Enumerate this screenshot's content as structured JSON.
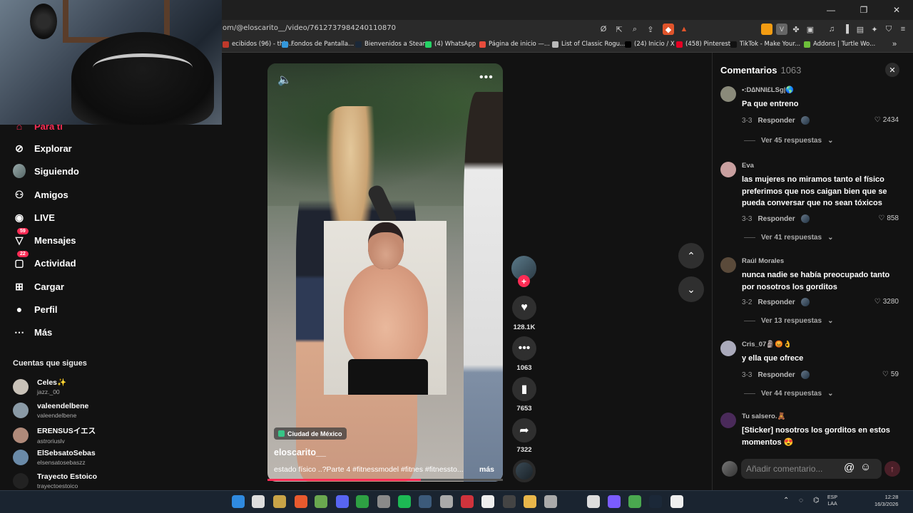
{
  "browser": {
    "url": "om/@eloscarito__/video/7612737984240110870",
    "bookmarks": [
      {
        "label": "ecibidos (96) - thia...",
        "color": "#c0392b"
      },
      {
        "label": "Fondos de Pantalla...",
        "color": "#3498db"
      },
      {
        "label": "Bienvenidos a Steam",
        "color": "#1b2838"
      },
      {
        "label": "(4) WhatsApp",
        "color": "#25d366"
      },
      {
        "label": "Página de inicio —...",
        "color": "#e74c3c"
      },
      {
        "label": "List of Classic Rogu...",
        "color": "#bbbbbb"
      },
      {
        "label": "(24) Inicio / X",
        "color": "#000000"
      },
      {
        "label": "(458) Pinterest",
        "color": "#e60023"
      },
      {
        "label": "TikTok - Make Your...",
        "color": "#111111"
      },
      {
        "label": "Addons | Turtle Wo...",
        "color": "#6dbf3a"
      }
    ]
  },
  "sidebar": {
    "items": [
      {
        "label": "Para ti",
        "icon": "home-icon"
      },
      {
        "label": "Explorar",
        "icon": "compass-icon"
      },
      {
        "label": "Siguiendo",
        "icon": "avatar"
      },
      {
        "label": "Amigos",
        "icon": "friends-icon"
      },
      {
        "label": "LIVE",
        "icon": "live-icon"
      },
      {
        "label": "Mensajes",
        "icon": "message-icon",
        "badge": "59"
      },
      {
        "label": "Actividad",
        "icon": "activity-icon",
        "badge": "22"
      },
      {
        "label": "Cargar",
        "icon": "upload-icon"
      },
      {
        "label": "Perfil",
        "icon": "profile-icon"
      },
      {
        "label": "Más",
        "icon": "more-icon"
      }
    ],
    "following_title": "Cuentas que sigues",
    "accounts": [
      {
        "name": "Celes✨",
        "user": "jazz._00"
      },
      {
        "name": "valeendelbene",
        "user": "valeendelbene"
      },
      {
        "name": "ERENSUSイエス",
        "user": "astroriuslv"
      },
      {
        "name": "ElSebsatoSebas",
        "user": "elsensatosebaszz"
      },
      {
        "name": "Trayecto Estoico",
        "user": "trayectoestoico"
      }
    ]
  },
  "video": {
    "location": "Ciudad de México",
    "author": "eloscarito__",
    "caption": "estado físico ..?Parte 4 #fitnessmodel #fitnes #fitnessto...",
    "more": "más",
    "progress": 0.65
  },
  "actions": {
    "likes": "128.1K",
    "comments": "1063",
    "saves": "7653",
    "shares": "7322"
  },
  "comments_panel": {
    "title": "Comentarios",
    "count": "1063",
    "input_placeholder": "Añadir comentario...",
    "reply_label": "Responder",
    "items": [
      {
        "user": "•:D∆NNI£LSg|🌎",
        "text": "Pa que entreno",
        "date": "3-3",
        "likes": "2434",
        "replies": "Ver 45 respuestas"
      },
      {
        "user": "Eva",
        "text": "las mujeres no miramos tanto el físico preferimos que nos caigan bien que se pueda conversar que no sean tóxicos",
        "date": "3-3",
        "likes": "858",
        "replies": "Ver 41 respuestas"
      },
      {
        "user": "Raúl Morales",
        "text": "nunca nadie se había preocupado tanto por nosotros los gorditos",
        "date": "3-2",
        "likes": "3280",
        "replies": "Ver 13 respuestas"
      },
      {
        "user": "Cris_07🗿😡👌",
        "text": "y ella que ofrece",
        "date": "3-3",
        "likes": "59",
        "replies": "Ver 44 respuestas"
      },
      {
        "user": "Tu salsero.🧸",
        "text": "[Sticker] nosotros los gorditos en estos momentos 😍",
        "date": "",
        "likes": "",
        "replies": ""
      }
    ]
  },
  "taskbar": {
    "lang_top": "ESP",
    "lang_bottom": "LAA",
    "time": "12:28",
    "date": "16/3/2026"
  }
}
